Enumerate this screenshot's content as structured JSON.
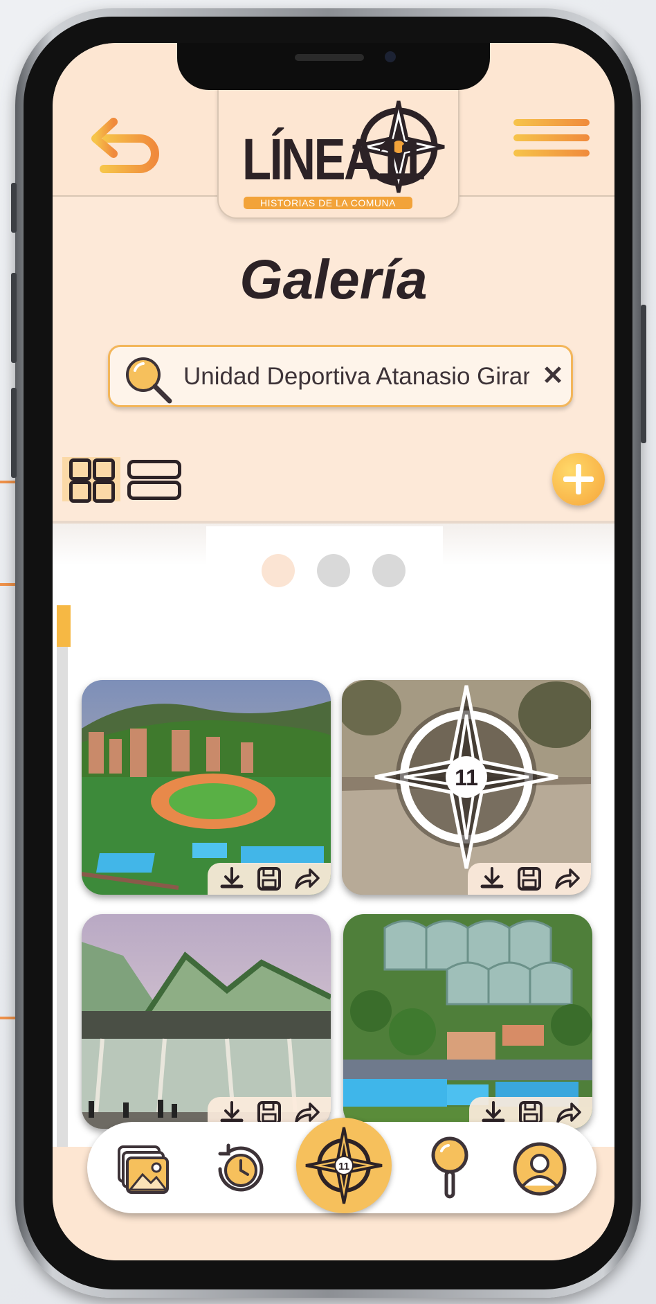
{
  "header": {
    "logo_text": "LÍNEA11",
    "logo_tagline": "HISTORIAS DE LA COMUNA"
  },
  "page": {
    "title": "Galería"
  },
  "search": {
    "value": "Unidad Deportiva Atanasio Girardot",
    "clear_label": "✕"
  },
  "view_toggle": {
    "active": "grid",
    "options": [
      "grid",
      "list"
    ]
  },
  "carousel": {
    "page_count": 3,
    "active_page": 1
  },
  "gallery": {
    "items": [
      {
        "image": "stadium-aerial-photo",
        "actions": [
          "download-icon",
          "save-icon",
          "share-icon"
        ]
      },
      {
        "image": "compass-placeholder-photo",
        "overlay_number": "11",
        "actions": [
          "download-icon",
          "save-icon",
          "share-icon"
        ]
      },
      {
        "image": "coliseum-photo",
        "actions": [
          "download-icon",
          "save-icon",
          "share-icon"
        ]
      },
      {
        "image": "sports-complex-aerial-photo",
        "actions": [
          "download-icon",
          "save-icon",
          "share-icon"
        ]
      }
    ]
  },
  "bottom_nav": {
    "items": [
      "gallery-icon",
      "history-clock-icon",
      "home-compass-icon",
      "search-pin-icon",
      "profile-icon"
    ],
    "active": "home-compass-icon",
    "center_number": "11"
  },
  "colors": {
    "accent_orange": "#f08a3c",
    "accent_yellow": "#f6c05c",
    "background": "#fde9d8",
    "text_dark": "#2c2226"
  }
}
